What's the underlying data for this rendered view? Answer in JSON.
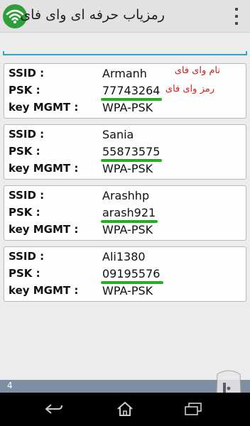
{
  "app": {
    "title": "رمزیاب حرفه ای وای فای",
    "logo_icon": "wifi-icon",
    "menu_icon": "overflow-menu-icon",
    "accent_color": "#2e9e3a"
  },
  "search": {
    "value": "",
    "placeholder": ""
  },
  "labels": {
    "ssid": "SSID :",
    "psk": "PSK :",
    "key_mgmt": "key MGMT :"
  },
  "networks": [
    {
      "ssid": "Armanh",
      "psk": "77743264",
      "key_mgmt": "WPA-PSK",
      "annotation_ssid": "نام وای فای",
      "annotation_psk": "رمز وای فای"
    },
    {
      "ssid": "Sania",
      "psk": "55873575",
      "key_mgmt": "WPA-PSK"
    },
    {
      "ssid": "Arashhp",
      "psk": "arash921",
      "key_mgmt": "WPA-PSK"
    },
    {
      "ssid": "Ali1380",
      "psk": "09195576",
      "key_mgmt": "WPA-PSK"
    }
  ],
  "status": {
    "count": "4"
  },
  "navigation": {
    "back_icon": "back-icon",
    "home_icon": "home-icon",
    "recents_icon": "recent-apps-icon"
  }
}
